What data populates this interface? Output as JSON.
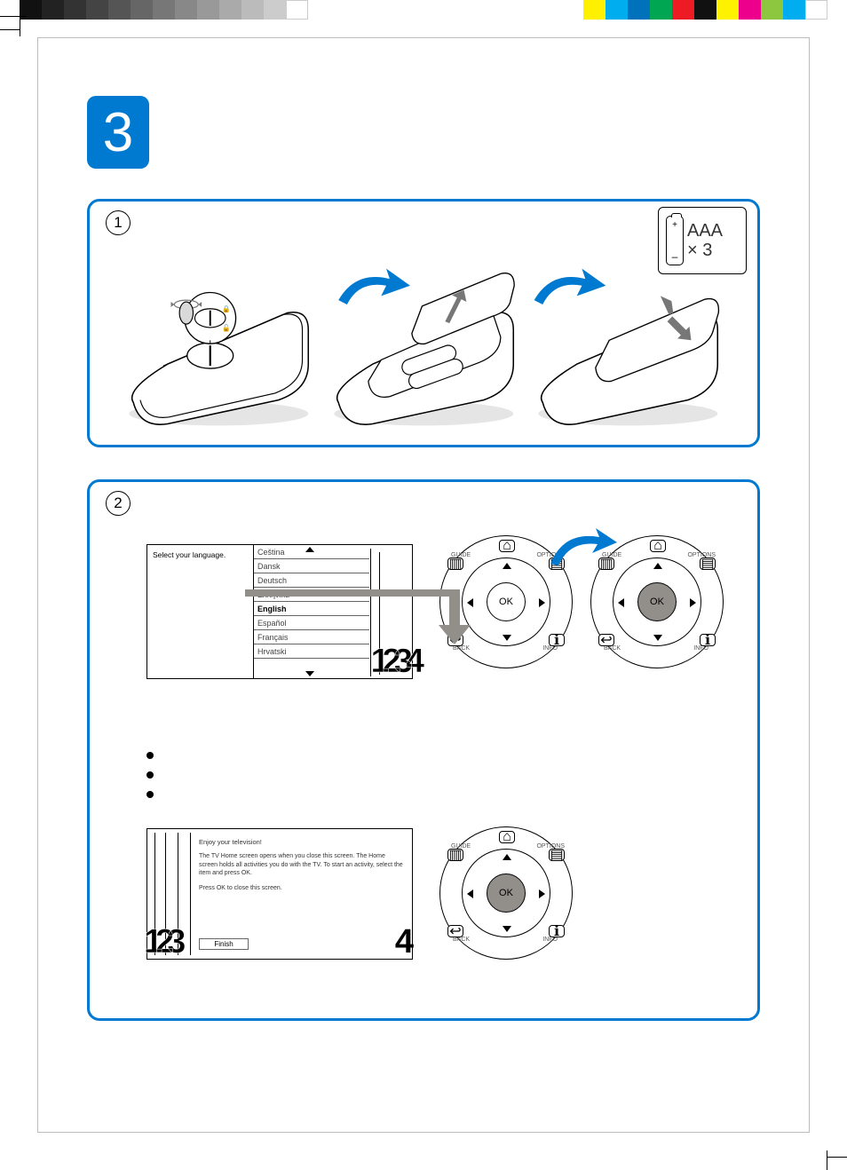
{
  "chapter_number": "3",
  "panel1": {
    "step": "1",
    "battery_label": "AAA",
    "battery_count": "× 3",
    "plus": "+",
    "minus": "–"
  },
  "panel2": {
    "step": "2",
    "lang_prompt": "Select your language.",
    "languages": [
      "Ceština",
      "Dansk",
      "Deutsch",
      "Ελληνικά",
      "English",
      "Español",
      "Français",
      "Hrvatski"
    ],
    "selected_language_index": 4,
    "bignums_lang": "1234",
    "dial_ok": "OK",
    "dial_labels": {
      "tl": "GUIDE",
      "tr": "OPTIONS",
      "bl": "BACK",
      "br": "INFO"
    },
    "finish": {
      "heading": "Enjoy your television!",
      "body": "The TV Home screen opens when you close this screen. The Home screen holds all activities you do with the TV. To start an activity, select the item and press OK.",
      "press": "Press OK to close this screen.",
      "button": "Finish",
      "left_nums": "123",
      "right_num": "4"
    }
  }
}
